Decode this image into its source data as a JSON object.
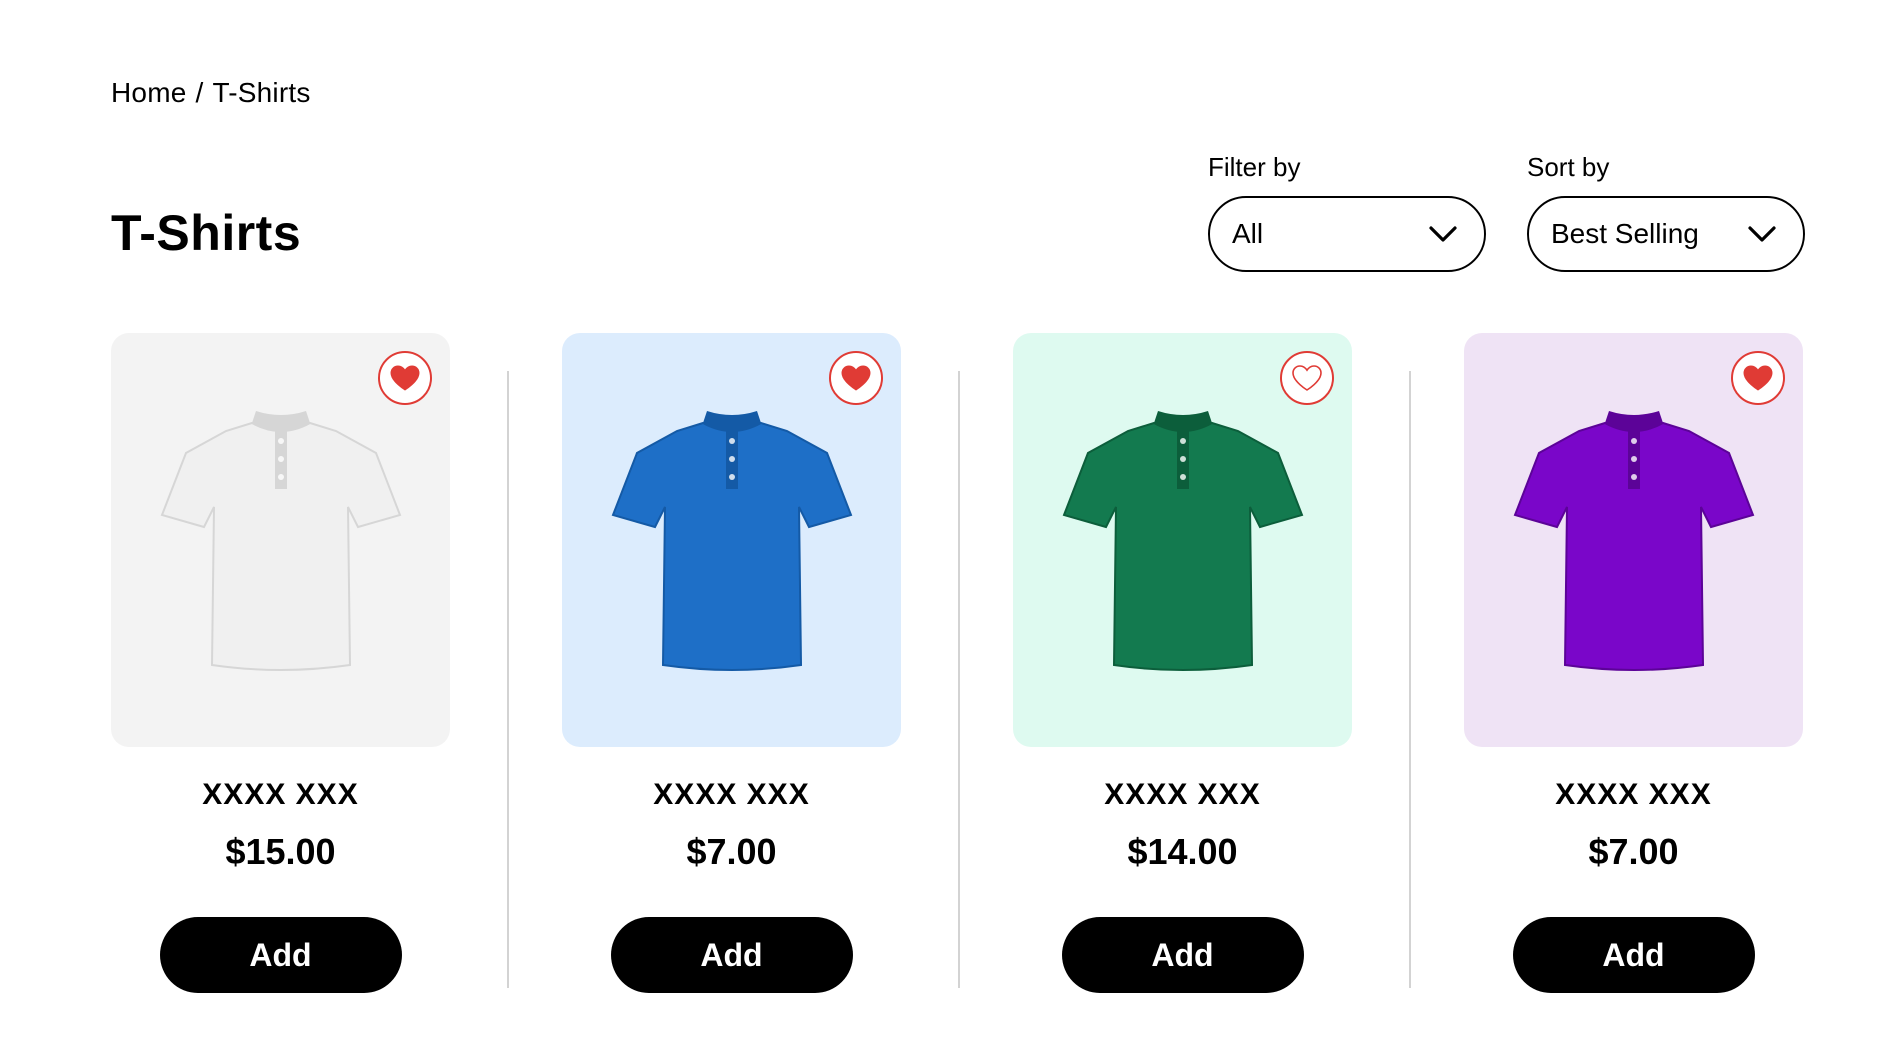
{
  "breadcrumb": {
    "home": "Home",
    "separator": "/",
    "current": "T-Shirts"
  },
  "page_title": "T-Shirts",
  "filter": {
    "label": "Filter by",
    "value": "All"
  },
  "sort": {
    "label": "Sort by",
    "value": "Best Selling"
  },
  "products": [
    {
      "name": "XXXX XXX",
      "price": "$15.00",
      "button": "Add",
      "favorited": true,
      "card_bg": "#f3f3f3",
      "shirt_color": "#f0f0f0",
      "shirt_shade": "#d6d6d6"
    },
    {
      "name": "XXXX XXX",
      "price": "$7.00",
      "button": "Add",
      "favorited": true,
      "card_bg": "#dcecfd",
      "shirt_color": "#1e6fc7",
      "shirt_shade": "#145aa6"
    },
    {
      "name": "XXXX XXX",
      "price": "$14.00",
      "button": "Add",
      "favorited": false,
      "card_bg": "#defaf0",
      "shirt_color": "#137a4f",
      "shirt_shade": "#0c5e3b"
    },
    {
      "name": "XXXX XXX",
      "price": "$7.00",
      "button": "Add",
      "favorited": true,
      "card_bg": "#efe3f5",
      "shirt_color": "#7a06c9",
      "shirt_shade": "#5c0398"
    }
  ],
  "colors": {
    "heart": "#e03b35",
    "button": "#000000",
    "divider": "#d3d3d3"
  },
  "icons": {
    "favorite": "heart-icon",
    "dropdown": "chevron-down-icon"
  }
}
